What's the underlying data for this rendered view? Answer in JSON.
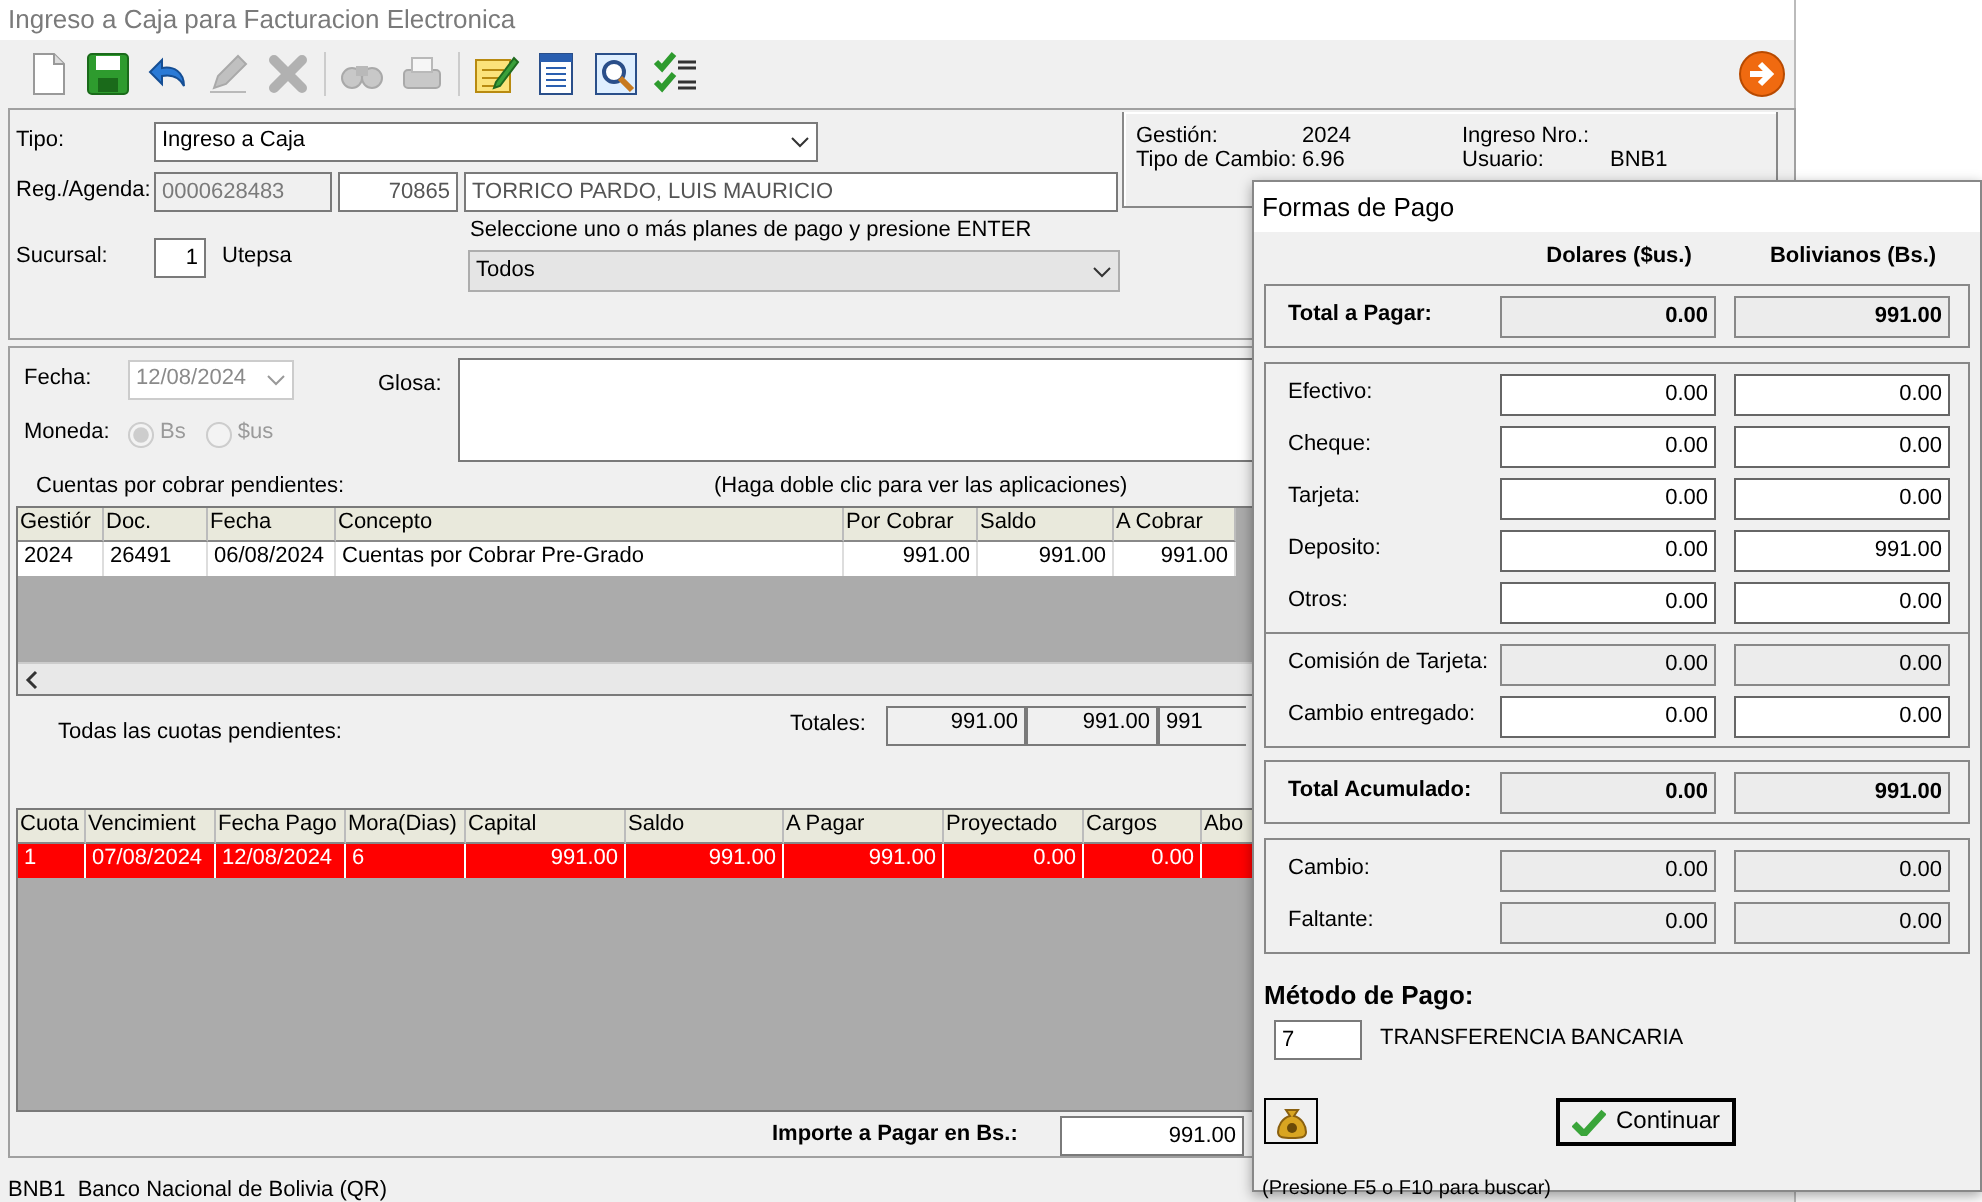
{
  "window": {
    "title": "Ingreso a Caja para Facturacion Electronica"
  },
  "toolbar": [
    {
      "kind": "new",
      "disabled": false
    },
    {
      "kind": "save",
      "disabled": false
    },
    {
      "kind": "undo",
      "disabled": false
    },
    {
      "kind": "edit",
      "disabled": true
    },
    {
      "kind": "delete",
      "disabled": true
    },
    {
      "kind": "find",
      "disabled": true
    },
    {
      "kind": "print",
      "disabled": true
    },
    {
      "kind": "notes",
      "disabled": false
    },
    {
      "kind": "list",
      "disabled": false
    },
    {
      "kind": "preview",
      "disabled": false
    },
    {
      "kind": "checklist",
      "disabled": false
    }
  ],
  "header": {
    "tipo_label": "Tipo:",
    "tipo_value": "Ingreso a Caja",
    "reg_label": "Reg./Agenda:",
    "reg_code": "0000628483",
    "reg_number": "70865",
    "reg_name": "TORRICO PARDO, LUIS MAURICIO",
    "sucursal_label": "Sucursal:",
    "sucursal_value": "1",
    "sucursal_name": "Utepsa",
    "plans_hint": "Seleccione uno o más planes de pago y presione ENTER",
    "plans_value": "Todos"
  },
  "info": {
    "left": [
      {
        "label": "Gestión:",
        "value": "2024"
      },
      {
        "label": "Tipo de Cambio:",
        "value": "6.96"
      }
    ],
    "right": [
      {
        "label": "Ingreso Nro.:"
      },
      {
        "label": "Usuario:",
        "value": "BNB1"
      }
    ]
  },
  "fecha": {
    "label": "Fecha:",
    "value": "12/08/2024",
    "disabled": true
  },
  "moneda": {
    "label": "Moneda:",
    "disabled": true,
    "options": [
      {
        "label": "Bs",
        "selected": true
      },
      {
        "label": "$us",
        "selected": false
      }
    ]
  },
  "glosa": {
    "label": "Glosa:"
  },
  "pending": {
    "title": "Cuentas por cobrar pendientes:",
    "hint": "(Haga doble clic para ver las aplicaciones)",
    "columns": [
      "Gestiór",
      "Doc.",
      "Fecha",
      "Concepto",
      "Por Cobrar",
      "Saldo",
      "A Cobrar"
    ],
    "rows": [
      {
        "cells": [
          "2024",
          "26491",
          "06/08/2024",
          "Cuentas por Cobrar Pre-Grado",
          "991.00",
          "991.00",
          "991.00"
        ],
        "overdue": false
      }
    ]
  },
  "totals": {
    "caption": "Todas las cuotas pendientes:",
    "label": "Totales:",
    "values": [
      "991.00",
      "991.00",
      "991"
    ]
  },
  "installments": {
    "columns": [
      "Cuota",
      "Vencimient",
      "Fecha Pago",
      "Mora(Dias)",
      "Capital",
      "Saldo",
      "A Pagar",
      "Proyectado",
      "Cargos",
      "Abo"
    ],
    "rows": [
      {
        "cells": [
          "1",
          "07/08/2024",
          "12/08/2024",
          "6",
          "991.00",
          "991.00",
          "991.00",
          "0.00",
          "0.00"
        ],
        "overdue": true
      }
    ]
  },
  "importe": {
    "label": "Importe a Pagar en Bs.:",
    "value": "991.00"
  },
  "status_bar": "BNB1  Banco Nacional de Bolivia (QR)",
  "dialog": {
    "title": "Formas de Pago",
    "col_headers": [
      "Dolares ($us.)",
      "Bolivianos (Bs.)"
    ],
    "groups": [
      {
        "rows": [
          {
            "label": "Total a Pagar:",
            "usd": "0.00",
            "bs": "991.00",
            "readonly": true,
            "bold": true
          }
        ]
      },
      {
        "rows": [
          {
            "label": "Efectivo:",
            "usd": "0.00",
            "bs": "0.00",
            "readonly": false,
            "bold": false
          },
          {
            "label": "Cheque:",
            "usd": "0.00",
            "bs": "0.00",
            "readonly": false,
            "bold": false
          },
          {
            "label": "Tarjeta:",
            "usd": "0.00",
            "bs": "0.00",
            "readonly": false,
            "bold": false
          },
          {
            "label": "Deposito:",
            "usd": "0.00",
            "bs": "991.00",
            "readonly": false,
            "bold": false
          },
          {
            "label": "Otros:",
            "usd": "0.00",
            "bs": "0.00",
            "readonly": false,
            "bold": false
          }
        ]
      },
      {
        "rows": [
          {
            "label": "Comisión de Tarjeta:",
            "usd": "0.00",
            "bs": "0.00",
            "readonly": true,
            "bold": false
          },
          {
            "label": "Cambio entregado:",
            "usd": "0.00",
            "bs": "0.00",
            "readonly": false,
            "bold": false
          }
        ]
      },
      {
        "rows": [
          {
            "label": "Total Acumulado:",
            "usd": "0.00",
            "bs": "991.00",
            "readonly": true,
            "bold": true
          }
        ]
      },
      {
        "rows": [
          {
            "label": "Cambio:",
            "usd": "0.00",
            "bs": "0.00",
            "readonly": true,
            "bold": false
          },
          {
            "label": "Faltante:",
            "usd": "0.00",
            "bs": "0.00",
            "readonly": true,
            "bold": false
          }
        ]
      }
    ],
    "method_label": "Método de Pago:",
    "method_code": "7",
    "method_name": "TRANSFERENCIA BANCARIA",
    "continue": "Continuar",
    "hint": "(Presione F5 o F10 para buscar)"
  }
}
